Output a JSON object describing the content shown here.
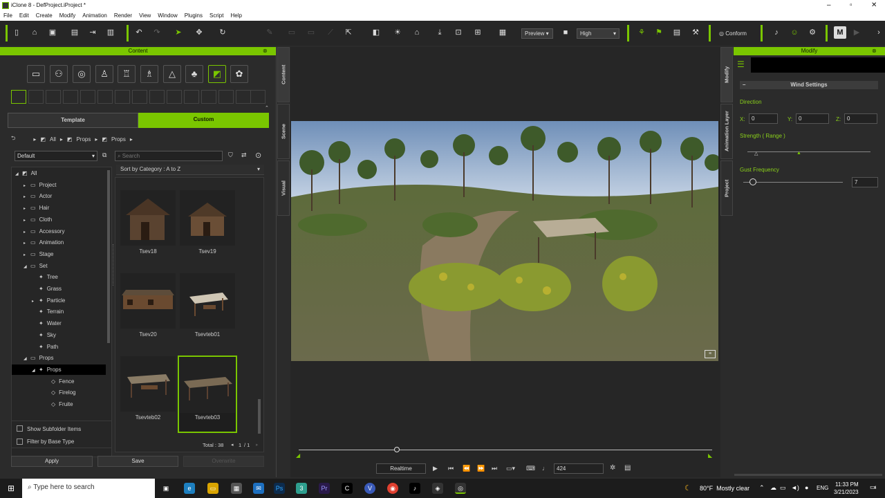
{
  "window": {
    "title": "iClone 8 - DefProject.iProject *"
  },
  "menu": [
    "File",
    "Edit",
    "Create",
    "Modify",
    "Animation",
    "Render",
    "View",
    "Window",
    "Plugins",
    "Script",
    "Help"
  ],
  "toolbar": {
    "preview_label": "Preview",
    "quality_label": "High",
    "conform_label": "Conform"
  },
  "content_panel": {
    "title": "Content",
    "tabs": {
      "template": "Template",
      "custom": "Custom"
    },
    "breadcrumb": [
      "All",
      "Props",
      "Props"
    ],
    "preset": "Default",
    "search_placeholder": "Search",
    "sort_label": "Sort by Category : A to Z",
    "side_tabs": {
      "content": "Content",
      "scene": "Scene",
      "visual": "Visual"
    },
    "tree": [
      {
        "label": "All",
        "level": 0
      },
      {
        "label": "Project",
        "level": 1
      },
      {
        "label": "Actor",
        "level": 1
      },
      {
        "label": "Hair",
        "level": 1
      },
      {
        "label": "Cloth",
        "level": 1
      },
      {
        "label": "Accessory",
        "level": 1
      },
      {
        "label": "Animation",
        "level": 1
      },
      {
        "label": "Stage",
        "level": 1
      },
      {
        "label": "Set",
        "level": 1
      },
      {
        "label": "Tree",
        "level": 2
      },
      {
        "label": "Grass",
        "level": 2
      },
      {
        "label": "Particle",
        "level": 2
      },
      {
        "label": "Terrain",
        "level": 2
      },
      {
        "label": "Water",
        "level": 2
      },
      {
        "label": "Sky",
        "level": 2
      },
      {
        "label": "Path",
        "level": 2
      },
      {
        "label": "Props",
        "level": 1
      },
      {
        "label": "Props",
        "level": 2
      },
      {
        "label": "Fence",
        "level": 3
      },
      {
        "label": "Firelog",
        "level": 3
      },
      {
        "label": "Fruite",
        "level": 3
      }
    ],
    "items": [
      "Tsev18",
      "Tsev19",
      "Tsev20",
      "Tsevteb01",
      "Tsevteb02",
      "Tsevteb03"
    ],
    "show_subfolder": "Show Subfolder Items",
    "filter_base": "Filter by Base Type",
    "total": "Total : 38",
    "page": "1",
    "page_total": "/ 1",
    "buttons": {
      "apply": "Apply",
      "save": "Save",
      "overwrite": "Overwrite"
    }
  },
  "viewport": {
    "timeline_mode": "Realtime",
    "frame": "424"
  },
  "modify_panel": {
    "title": "Modify",
    "side_tabs": {
      "modify": "Modify",
      "animation_layer": "Animation Layer",
      "project": "Project"
    },
    "section": "Wind Settings",
    "direction_label": "Direction",
    "x_label": "X:",
    "x_value": "0",
    "y_label": "Y:",
    "y_value": "0",
    "z_label": "Z:",
    "z_value": "0",
    "strength_label": "Strength ( Range )",
    "gust_label": "Gust Frequency",
    "gust_value": "7"
  },
  "taskbar": {
    "search_placeholder": "Type here to search",
    "weather": "80°F  Mostly clear",
    "lang": "ENG",
    "time": "11:33 PM",
    "date": "3/21/2023",
    "notif": "4"
  },
  "colors": {
    "accent": "#7ac600",
    "panel_bg": "#2b2b2b"
  }
}
